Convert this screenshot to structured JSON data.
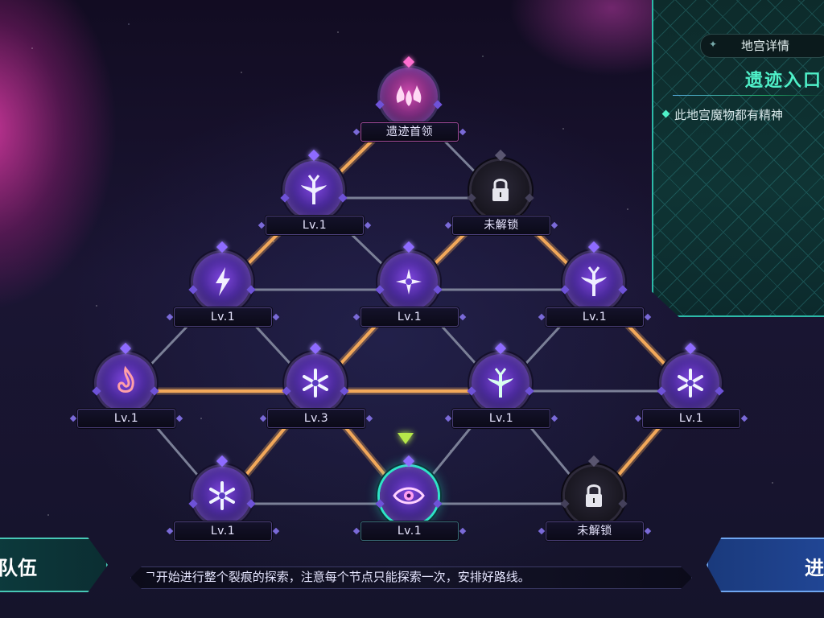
{
  "panel": {
    "tab_label": "地宫详情",
    "title": "遗迹入口",
    "description": "此地宫魔物都有精神",
    "accent_color": "#4ff0c8"
  },
  "bottom": {
    "team_label": "队伍",
    "enter_label": "进",
    "hint": "ᄀ开始进行整个裂痕的探索，注意每个节点只能探索一次，安排好路线。"
  },
  "nodes": [
    {
      "id": "boss",
      "label": "遗迹首领",
      "icon": "flame-crown-icon",
      "state": "boss"
    },
    {
      "id": "r1a",
      "label": "Lv.1",
      "icon": "tree-icon",
      "state": "open"
    },
    {
      "id": "r1b",
      "label": "未解锁",
      "icon": "lock-icon",
      "state": "locked"
    },
    {
      "id": "r2a",
      "label": "Lv.1",
      "icon": "lightning-icon",
      "state": "open"
    },
    {
      "id": "r2b",
      "label": "Lv.1",
      "icon": "swirl-star-icon",
      "state": "open"
    },
    {
      "id": "r2c",
      "label": "Lv.1",
      "icon": "tree-icon",
      "state": "open"
    },
    {
      "id": "r3a",
      "label": "Lv.1",
      "icon": "flame-rune-icon",
      "state": "open"
    },
    {
      "id": "r3b",
      "label": "Lv.3",
      "icon": "snowflake-icon",
      "state": "open"
    },
    {
      "id": "r3c",
      "label": "Lv.1",
      "icon": "tree-icon",
      "state": "open"
    },
    {
      "id": "r3d",
      "label": "Lv.1",
      "icon": "snowflake-icon",
      "state": "open"
    },
    {
      "id": "r4a",
      "label": "Lv.1",
      "icon": "snowflake-icon",
      "state": "open"
    },
    {
      "id": "r4b",
      "label": "Lv.1",
      "icon": "eye-icon",
      "state": "current"
    },
    {
      "id": "r4c",
      "label": "未解锁",
      "icon": "lock-icon",
      "state": "locked"
    }
  ],
  "colors": {
    "path_active": "#f2a85a",
    "path_inactive": "#7b8097",
    "current_ring": "#2fe3c8",
    "indicator": "#b6e84a"
  }
}
